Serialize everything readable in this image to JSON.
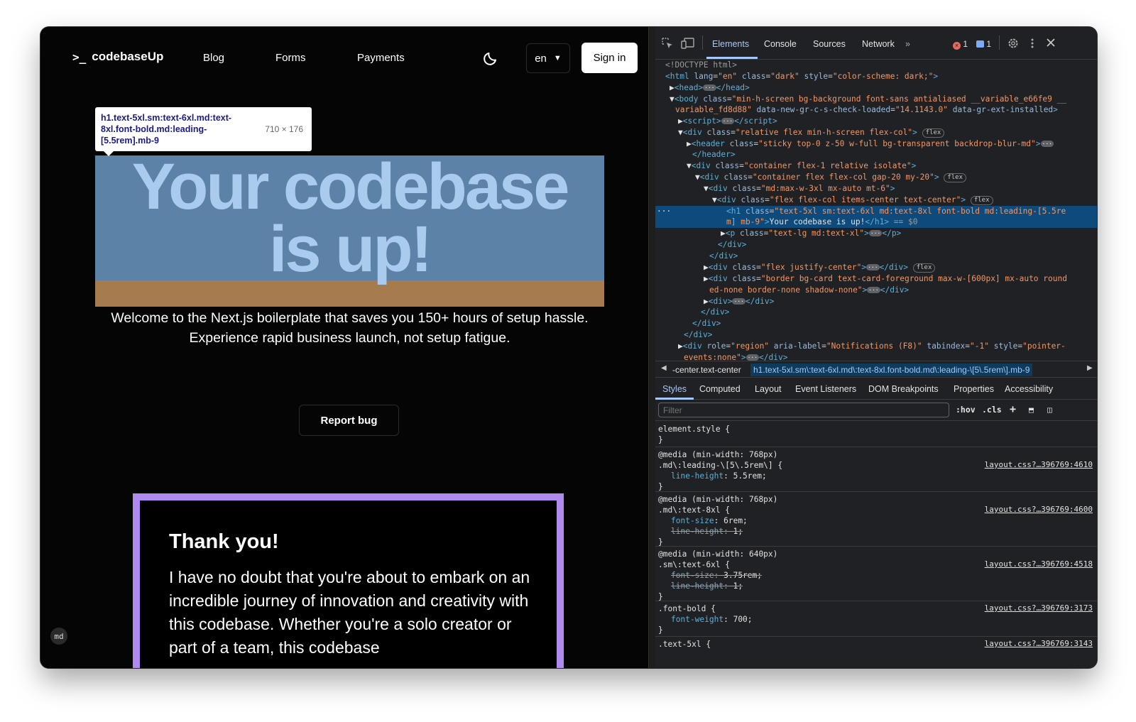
{
  "site": {
    "logo": {
      "prompt": ">_",
      "name": "codebaseUp"
    },
    "nav": [
      "Blog",
      "Forms",
      "Payments"
    ],
    "lang": {
      "value": "en",
      "caret": "▼"
    },
    "signin": "Sign in",
    "tooltip": {
      "selector": "h1.text-5xl.sm:text-6xl.md:text-8xl.font-bold.md:leading-[5.5rem].mb-9",
      "size": "710 × 176"
    },
    "hero": {
      "line1": "Your codebase",
      "line2": "is up!"
    },
    "subtitle": {
      "line1": "Welcome to the Next.js boilerplate that saves you 150+ hours of setup hassle.",
      "line2": "Experience rapid business launch, not setup fatigue."
    },
    "report_bug": "Report bug",
    "card": {
      "title": "Thank you!",
      "body": "I have no doubt that you're about to embark on an incredible journey of innovation and creativity with this codebase. Whether you're a solo creator or part of a team, this codebase"
    },
    "breakpoint_badge": "md"
  },
  "devtools": {
    "tabs": [
      "Elements",
      "Console",
      "Sources",
      "Network",
      "»"
    ],
    "errors": "1",
    "messages": "1",
    "dom": [
      {
        "html": "<span class=\"cmt\">&lt;!DOCTYPE html&gt;</span>"
      },
      {
        "html": "<span class=\"tag\">&lt;html</span> <span class=\"attr\">lang</span>=<span class=\"val\">\"en\"</span> <span class=\"attr\">class</span>=<span class=\"val\">\"dark\"</span> <span class=\"attr\">style</span>=<span class=\"val\">\"color-scheme: dark;\"</span><span class=\"tag\">&gt;</span>"
      },
      {
        "html": "<span class=\"txt\">▶</span><span class=\"tag\">&lt;head&gt;</span><span class=\"ell\">···</span><span class=\"tag\">&lt;/head&gt;</span>"
      },
      {
        "html": "<span class=\"txt\">▼</span><span class=\"tag\">&lt;body</span> <span class=\"attr\">class</span>=<span class=\"val\">\"min-h-screen bg-background font-sans antialiased __variable_e66fe9 __</span>"
      },
      {
        "html": "<span class=\"val\">variable_fd8d88\"</span> <span class=\"attr\">data-new-gr-c-s-check-loaded</span>=<span class=\"val\">\"14.1143.0\"</span> <span class=\"attr\">data-gr-ext-installed</span><span class=\"tag\">&gt;</span>"
      },
      {
        "html": "<span class=\"txt\">▶</span><span class=\"tag\">&lt;script&gt;</span><span class=\"ell\">···</span><span class=\"tag\">&lt;/script&gt;</span>"
      },
      {
        "html": "<span class=\"txt\">▼</span><span class=\"tag\">&lt;div</span> <span class=\"attr\">class</span>=<span class=\"val\">\"relative flex min-h-screen flex-col\"</span><span class=\"tag\">&gt;</span> <span class=\"badge\">flex</span>"
      },
      {
        "html": "<span class=\"txt\">▶</span><span class=\"tag\">&lt;header</span> <span class=\"attr\">class</span>=<span class=\"val\">\"sticky top-0 z-50 w-full bg-transparent backdrop-blur-md\"</span><span class=\"tag\">&gt;</span><span class=\"ell\">···</span>"
      },
      {
        "html": "<span class=\"tag\">&lt;/header&gt;</span>"
      },
      {
        "html": "<span class=\"txt\">▼</span><span class=\"tag\">&lt;div</span> <span class=\"attr\">class</span>=<span class=\"val\">\"container flex-1 relative isolate\"</span><span class=\"tag\">&gt;</span>"
      },
      {
        "html": "<span class=\"txt\">▼</span><span class=\"tag\">&lt;div</span> <span class=\"attr\">class</span>=<span class=\"val\">\"container flex flex-col gap-20 my-20\"</span><span class=\"tag\">&gt;</span> <span class=\"badge\">flex</span>"
      },
      {
        "html": "<span class=\"txt\">▼</span><span class=\"tag\">&lt;div</span> <span class=\"attr\">class</span>=<span class=\"val\">\"md:max-w-3xl mx-auto mt-6\"</span><span class=\"tag\">&gt;</span>"
      },
      {
        "html": "<span class=\"txt\">▼</span><span class=\"tag\">&lt;div</span> <span class=\"attr\">class</span>=<span class=\"val\">\"flex flex-col items-center text-center\"</span><span class=\"tag\">&gt;</span> <span class=\"badge\">flex</span>"
      },
      {
        "html": "<span class=\"tag\">&lt;h1</span> <span class=\"attr\">class</span>=<span class=\"val\">\"text-5xl sm:text-6xl md:text-8xl font-bold md:leading-[5.5re</span>"
      },
      {
        "html": "<span class=\"val\">m] mb-9\"</span><span class=\"tag\">&gt;</span><span class=\"txt\">Your codebase is up!</span><span class=\"tag\">&lt;/h1&gt;</span> <span class=\"cmt\">== $0</span>"
      },
      {
        "html": "<span class=\"txt\">▶</span><span class=\"tag\">&lt;p</span> <span class=\"attr\">class</span>=<span class=\"val\">\"text-lg md:text-xl\"</span><span class=\"tag\">&gt;</span><span class=\"ell\">···</span><span class=\"tag\">&lt;/p&gt;</span>"
      },
      {
        "html": "<span class=\"tag\">&lt;/div&gt;</span>"
      },
      {
        "html": "<span class=\"tag\">&lt;/div&gt;</span>"
      },
      {
        "html": "<span class=\"txt\">▶</span><span class=\"tag\">&lt;div</span> <span class=\"attr\">class</span>=<span class=\"val\">\"flex justify-center\"</span><span class=\"tag\">&gt;</span><span class=\"ell\">···</span><span class=\"tag\">&lt;/div&gt;</span> <span class=\"badge\">flex</span>"
      },
      {
        "html": "<span class=\"txt\">▶</span><span class=\"tag\">&lt;div</span> <span class=\"attr\">class</span>=<span class=\"val\">\"border bg-card text-card-foreground max-w-[600px] mx-auto round</span>"
      },
      {
        "html": "<span class=\"val\">ed-none border-none shadow-none\"</span><span class=\"tag\">&gt;</span><span class=\"ell\">···</span><span class=\"tag\">&lt;/div&gt;</span>"
      },
      {
        "html": "<span class=\"txt\">▶</span><span class=\"tag\">&lt;div&gt;</span><span class=\"ell\">···</span><span class=\"tag\">&lt;/div&gt;</span>"
      },
      {
        "html": "<span class=\"tag\">&lt;/div&gt;</span>"
      },
      {
        "html": "<span class=\"tag\">&lt;/div&gt;</span>"
      },
      {
        "html": "<span class=\"tag\">&lt;/div&gt;</span>"
      },
      {
        "html": "<span class=\"txt\">▶</span><span class=\"tag\">&lt;div</span> <span class=\"attr\">role</span>=<span class=\"val\">\"region\"</span> <span class=\"attr\">aria-label</span>=<span class=\"val\">\"Notifications (F8)\"</span> <span class=\"attr\">tabindex</span>=<span class=\"val\">\"-1\"</span> <span class=\"attr\">style</span>=<span class=\"val\">\"pointer-</span>"
      },
      {
        "html": "<span class=\"val\">events:none\"</span><span class=\"tag\">&gt;</span><span class=\"ell\">···</span><span class=\"tag\">&lt;/div&gt;</span>"
      }
    ],
    "breadcrumbs": [
      "-center.text-center",
      "h1.text-5xl.sm\\:text-6xl.md\\:text-8xl.font-bold.md\\:leading-\\[5\\.5rem\\].mb-9"
    ],
    "style_tabs": [
      "Styles",
      "Computed",
      "Layout",
      "Event Listeners",
      "DOM Breakpoints",
      "Properties",
      "Accessibility"
    ],
    "filter_placeholder": "Filter",
    "filter_buttons": [
      ":hov",
      ".cls",
      "+",
      "⬒",
      "◫"
    ],
    "rules": [
      {
        "lines": [
          "element.style {",
          "}"
        ],
        "props": [],
        "source": ""
      },
      {
        "lines": [
          "@media (min-width: 768px)",
          ".md\\:leading-\\[5\\.5rem\\] {"
        ],
        "props": [
          {
            "name": "line-height",
            "value": "5.5rem;",
            "struck": false
          }
        ],
        "close": "}",
        "source": "layout.css?…396769:4610"
      },
      {
        "lines": [
          "@media (min-width: 768px)",
          ".md\\:text-8xl {"
        ],
        "props": [
          {
            "name": "font-size",
            "value": "6rem;",
            "struck": false
          },
          {
            "name": "line-height",
            "value": "1;",
            "struck": true
          }
        ],
        "close": "}",
        "source": "layout.css?…396769:4600"
      },
      {
        "lines": [
          "@media (min-width: 640px)",
          ".sm\\:text-6xl {"
        ],
        "props": [
          {
            "name": "font-size",
            "value": "3.75rem;",
            "struck": true
          },
          {
            "name": "line-height",
            "value": "1;",
            "struck": true
          }
        ],
        "close": "}",
        "source": "layout.css?…396769:4518"
      },
      {
        "lines": [
          ".font-bold {"
        ],
        "props": [
          {
            "name": "font-weight",
            "value": "700;",
            "struck": false
          }
        ],
        "close": "}",
        "source": "layout.css?…396769:3173"
      },
      {
        "lines": [
          ".text-5xl {"
        ],
        "props": [],
        "close": "",
        "source": "layout.css?…396769:3143"
      }
    ]
  }
}
